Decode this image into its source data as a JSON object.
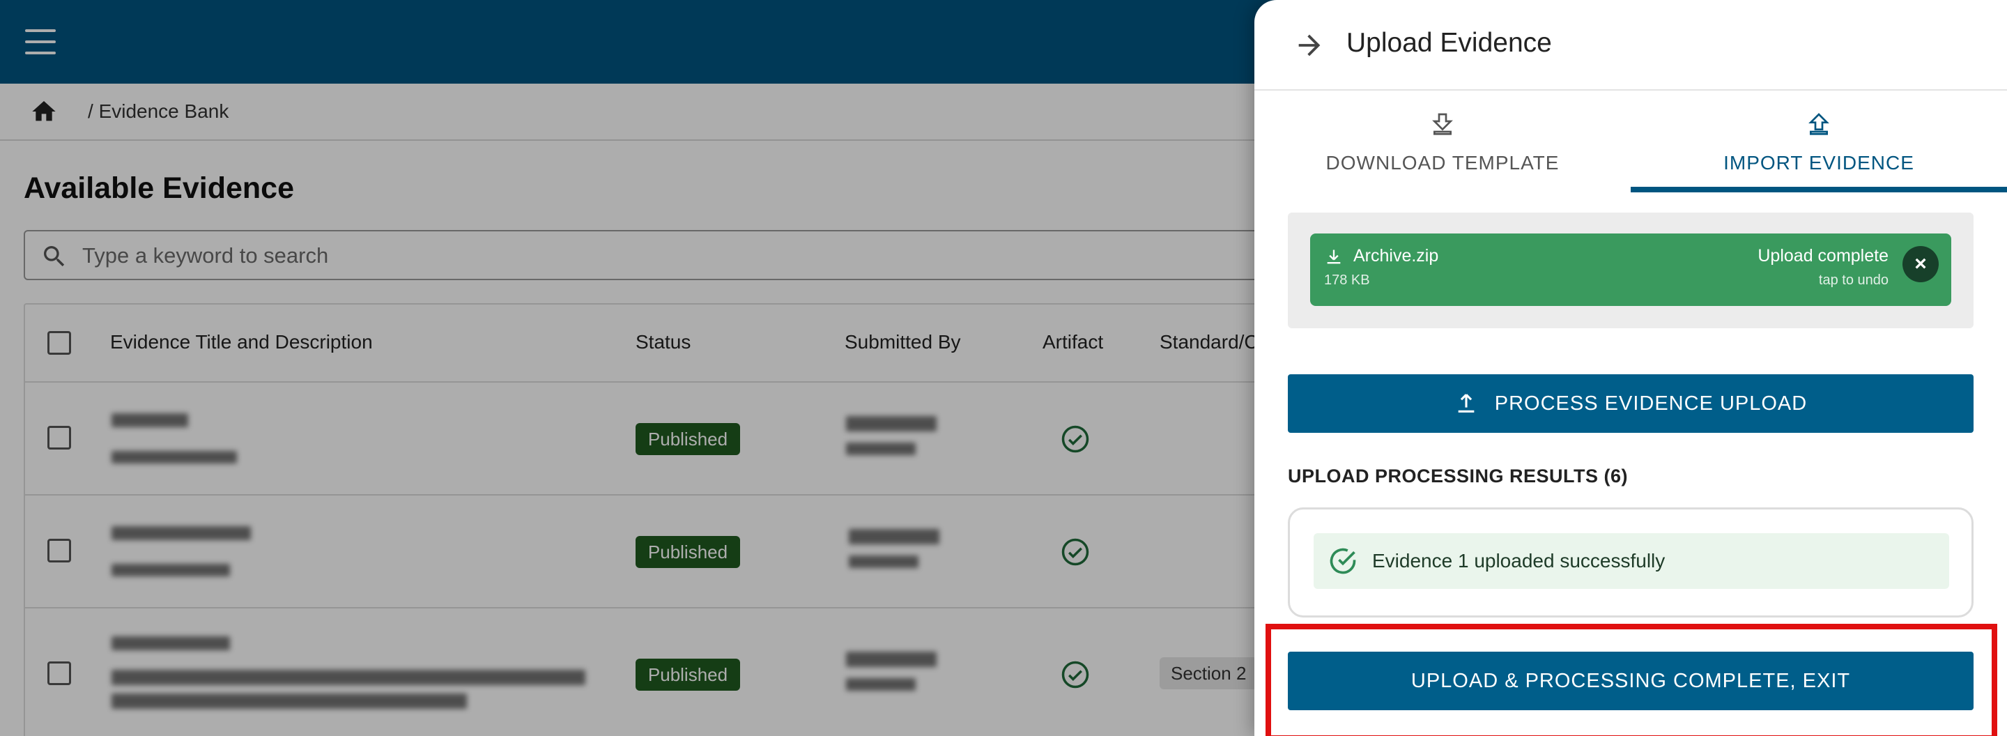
{
  "breadcrumb": {
    "separator": "/",
    "current": "Evidence Bank"
  },
  "page": {
    "title": "Available Evidence"
  },
  "search": {
    "placeholder": "Type a keyword to search"
  },
  "table": {
    "headers": [
      "Evidence Title and Description",
      "Status",
      "Submitted By",
      "Artifact",
      "Standard/C"
    ],
    "rows": [
      {
        "status": "Published",
        "standard": ""
      },
      {
        "status": "Published",
        "standard": ""
      },
      {
        "status": "Published",
        "standard": "Section 2"
      }
    ]
  },
  "drawer": {
    "title": "Upload Evidence",
    "tabs": [
      {
        "label": "DOWNLOAD TEMPLATE",
        "icon": "download-icon"
      },
      {
        "label": "IMPORT EVIDENCE",
        "icon": "upload-icon",
        "active": true
      }
    ],
    "file": {
      "name": "Archive.zip",
      "size": "178 KB",
      "status": "Upload complete",
      "undo_hint": "tap to undo"
    },
    "process_button": "PROCESS EVIDENCE UPLOAD",
    "results_heading": "UPLOAD PROCESSING RESULTS (6)",
    "results": [
      {
        "text": "Evidence 1 uploaded successfully"
      }
    ],
    "exit_button": "UPLOAD & PROCESSING COMPLETE, EXIT"
  },
  "colors": {
    "appbar": "#005580",
    "primary_button": "#005e8a",
    "published_badge": "#1f5a1f",
    "upload_complete": "#3a9a5e",
    "highlight": "#e01010"
  }
}
